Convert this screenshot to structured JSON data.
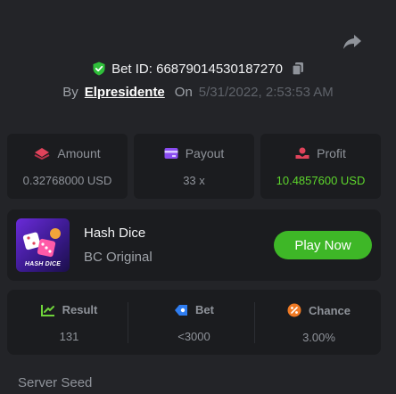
{
  "header": {
    "bet_id_label": "Bet ID: 66879014530187270",
    "by_label": "By",
    "username": "Elpresidente",
    "on_label": "On",
    "date": "5/31/2022, 2:53:53 AM"
  },
  "stats": [
    {
      "title": "Amount",
      "value": "0.32768000 USD",
      "icon": "amount-icon"
    },
    {
      "title": "Payout",
      "value": "33 x",
      "icon": "payout-icon"
    },
    {
      "title": "Profit",
      "value": "10.4857600 USD",
      "icon": "profit-icon"
    }
  ],
  "game": {
    "name": "Hash Dice",
    "provider": "BC Original",
    "thumbnail_text": "HASH DICE",
    "play_label": "Play Now"
  },
  "results": [
    {
      "title": "Result",
      "value": "131",
      "icon": "result-icon"
    },
    {
      "title": "Bet",
      "value": "<3000",
      "icon": "bet-icon"
    },
    {
      "title": "Chance",
      "value": "3.00%",
      "icon": "chance-icon"
    }
  ],
  "server_seed_label": "Server Seed",
  "colors": {
    "background": "#232428",
    "card": "#1b1c1f",
    "accent_green": "#3eb727",
    "profit_green": "#5dd62c"
  }
}
